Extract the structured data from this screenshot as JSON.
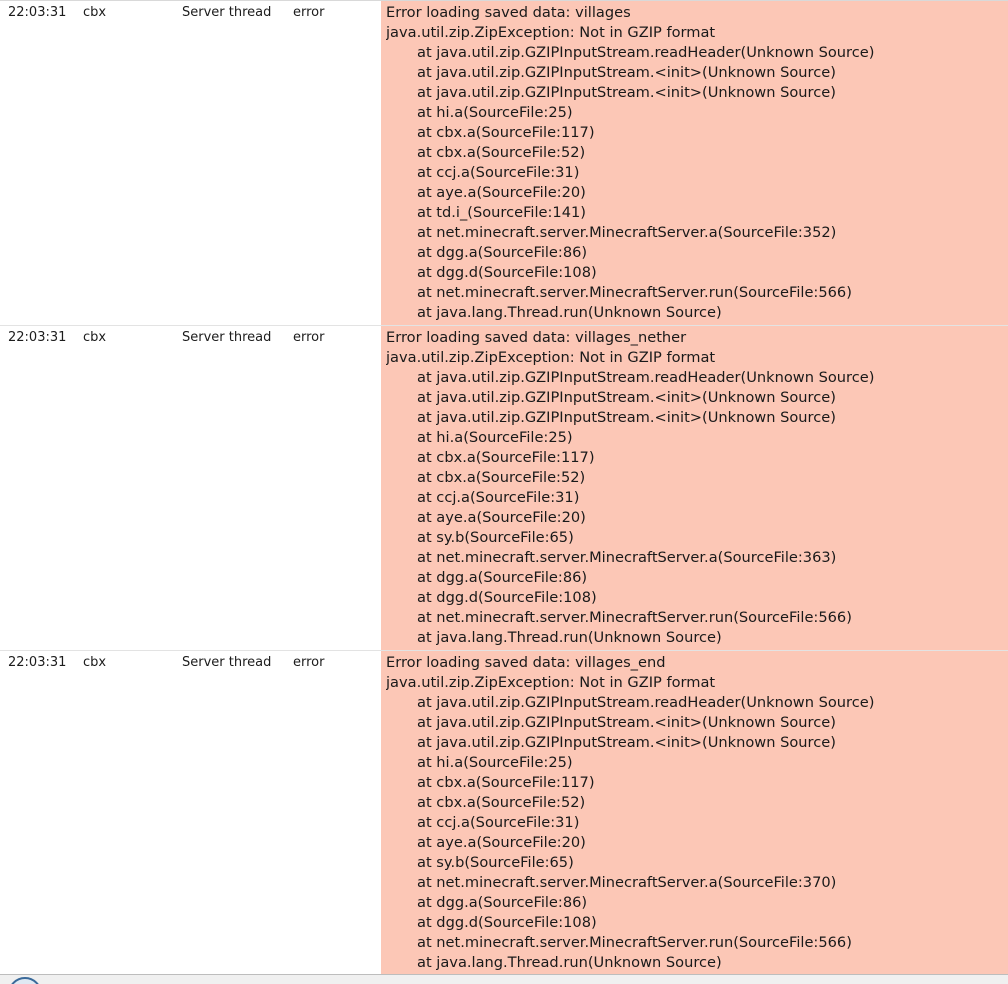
{
  "log_entries": [
    {
      "time": "22:03:31",
      "logger": "cbx",
      "thread": "Server thread",
      "level": "error",
      "message": [
        "Error loading saved data: villages",
        "java.util.zip.ZipException: Not in GZIP format"
      ],
      "stack": [
        "at java.util.zip.GZIPInputStream.readHeader(Unknown Source)",
        "at java.util.zip.GZIPInputStream.<init>(Unknown Source)",
        "at java.util.zip.GZIPInputStream.<init>(Unknown Source)",
        "at hi.a(SourceFile:25)",
        "at cbx.a(SourceFile:117)",
        "at cbx.a(SourceFile:52)",
        "at ccj.a(SourceFile:31)",
        "at aye.a(SourceFile:20)",
        "at td.i_(SourceFile:141)",
        "at net.minecraft.server.MinecraftServer.a(SourceFile:352)",
        "at dgg.a(SourceFile:86)",
        "at dgg.d(SourceFile:108)",
        "at net.minecraft.server.MinecraftServer.run(SourceFile:566)",
        "at java.lang.Thread.run(Unknown Source)"
      ]
    },
    {
      "time": "22:03:31",
      "logger": "cbx",
      "thread": "Server thread",
      "level": "error",
      "message": [
        "Error loading saved data: villages_nether",
        "java.util.zip.ZipException: Not in GZIP format"
      ],
      "stack": [
        "at java.util.zip.GZIPInputStream.readHeader(Unknown Source)",
        "at java.util.zip.GZIPInputStream.<init>(Unknown Source)",
        "at java.util.zip.GZIPInputStream.<init>(Unknown Source)",
        "at hi.a(SourceFile:25)",
        "at cbx.a(SourceFile:117)",
        "at cbx.a(SourceFile:52)",
        "at ccj.a(SourceFile:31)",
        "at aye.a(SourceFile:20)",
        "at sy.b(SourceFile:65)",
        "at net.minecraft.server.MinecraftServer.a(SourceFile:363)",
        "at dgg.a(SourceFile:86)",
        "at dgg.d(SourceFile:108)",
        "at net.minecraft.server.MinecraftServer.run(SourceFile:566)",
        "at java.lang.Thread.run(Unknown Source)"
      ]
    },
    {
      "time": "22:03:31",
      "logger": "cbx",
      "thread": "Server thread",
      "level": "error",
      "message": [
        "Error loading saved data: villages_end",
        "java.util.zip.ZipException: Not in GZIP format"
      ],
      "stack": [
        "at java.util.zip.GZIPInputStream.readHeader(Unknown Source)",
        "at java.util.zip.GZIPInputStream.<init>(Unknown Source)",
        "at java.util.zip.GZIPInputStream.<init>(Unknown Source)",
        "at hi.a(SourceFile:25)",
        "at cbx.a(SourceFile:117)",
        "at cbx.a(SourceFile:52)",
        "at ccj.a(SourceFile:31)",
        "at aye.a(SourceFile:20)",
        "at sy.b(SourceFile:65)",
        "at net.minecraft.server.MinecraftServer.a(SourceFile:370)",
        "at dgg.a(SourceFile:86)",
        "at dgg.d(SourceFile:108)",
        "at net.minecraft.server.MinecraftServer.run(SourceFile:566)",
        "at java.lang.Thread.run(Unknown Source)"
      ]
    }
  ],
  "colors": {
    "error_background": "#fcc7b6",
    "row_divider": "#e3e3e3"
  },
  "icons": {
    "status_icon": "round-status-icon"
  }
}
